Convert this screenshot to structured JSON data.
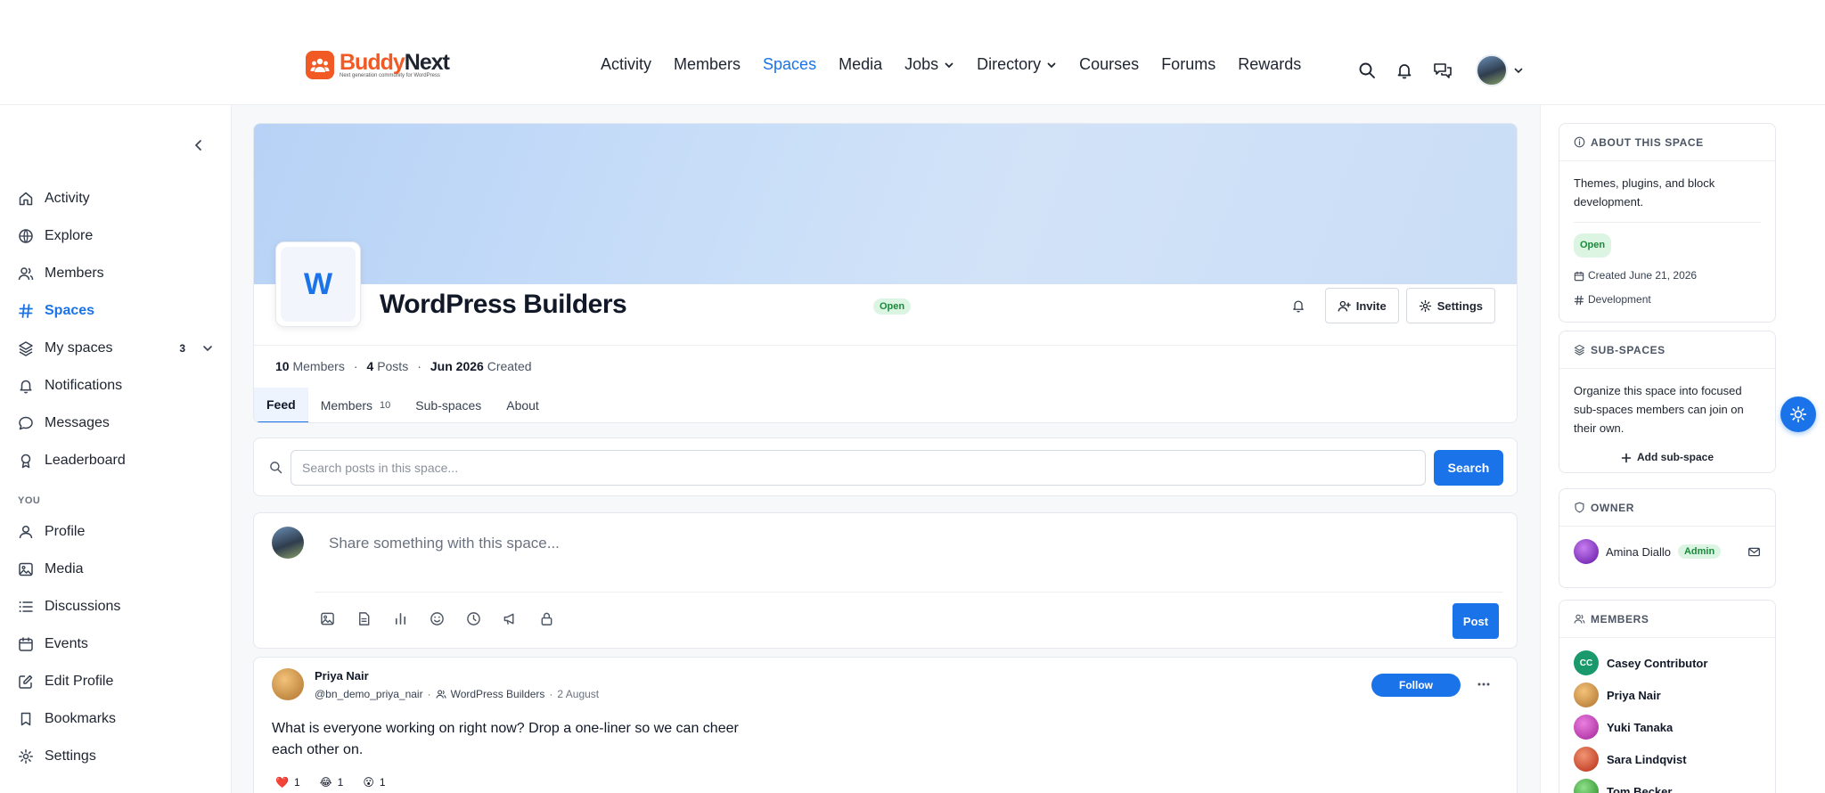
{
  "brand": {
    "name_a": "Buddy",
    "name_b": "Next",
    "tagline": "Next generation community for WordPress",
    "color": "#f15a24"
  },
  "nav": [
    {
      "label": "Activity"
    },
    {
      "label": "Members"
    },
    {
      "label": "Spaces",
      "active": true
    },
    {
      "label": "Media"
    },
    {
      "label": "Jobs",
      "dropdown": true
    },
    {
      "label": "Directory",
      "dropdown": true
    },
    {
      "label": "Courses"
    },
    {
      "label": "Forums"
    },
    {
      "label": "Rewards"
    }
  ],
  "header_icons": [
    "search-icon",
    "bell-icon",
    "messages-icon",
    "avatar",
    "chevron-down-icon"
  ],
  "sidebar": {
    "items": [
      {
        "label": "Activity",
        "icon": "home-icon"
      },
      {
        "label": "Explore",
        "icon": "globe-icon"
      },
      {
        "label": "Members",
        "icon": "user-icon"
      },
      {
        "label": "Spaces",
        "icon": "hash-icon",
        "active": true
      },
      {
        "label": "My spaces",
        "icon": "layers-icon",
        "badge": "3"
      },
      {
        "label": "Notifications",
        "icon": "bell-icon"
      },
      {
        "label": "Messages",
        "icon": "chat-icon"
      },
      {
        "label": "Leaderboard",
        "icon": "award-icon"
      }
    ],
    "section_you": "YOU",
    "you_items": [
      {
        "label": "Profile",
        "icon": "user-icon"
      },
      {
        "label": "Media",
        "icon": "image-icon"
      },
      {
        "label": "Discussions",
        "icon": "list-icon"
      },
      {
        "label": "Events",
        "icon": "calendar-icon"
      },
      {
        "label": "Edit Profile",
        "icon": "edit-icon"
      },
      {
        "label": "Bookmarks",
        "icon": "bookmark-icon"
      },
      {
        "label": "Settings",
        "icon": "gear-icon"
      }
    ]
  },
  "space": {
    "initial": "W",
    "title": "WordPress Builders",
    "status": "Open",
    "invite_label": "Invite",
    "settings_label": "Settings",
    "stats": {
      "members_count": "10",
      "members_label": "Members",
      "posts_count": "4",
      "posts_label": "Posts",
      "created_date": "Jun 2026",
      "created_label": "Created"
    },
    "tabs": [
      {
        "label": "Feed",
        "active": true
      },
      {
        "label": "Members",
        "count": "10"
      },
      {
        "label": "Sub-spaces"
      },
      {
        "label": "About"
      }
    ]
  },
  "search": {
    "placeholder": "Search posts in this space...",
    "button": "Search"
  },
  "composer": {
    "placeholder": "Share something with this space...",
    "post_label": "Post"
  },
  "post": {
    "author": "Priya Nair",
    "handle": "@bn_demo_priya_nair",
    "space": "WordPress Builders",
    "date": "2 August",
    "follow_label": "Follow",
    "body": "What is everyone working on right now? Drop a one-liner so we can cheer each other on.",
    "reactions": [
      {
        "emoji": "❤️",
        "count": "1"
      },
      {
        "emoji": "😂",
        "count": "1"
      },
      {
        "emoji": "😮",
        "count": "1"
      }
    ]
  },
  "about": {
    "heading": "ABOUT THIS SPACE",
    "description": "Themes, plugins, and block development.",
    "status": "Open",
    "created": "Created June 21, 2026",
    "category": "Development"
  },
  "subspaces": {
    "heading": "SUB-SPACES",
    "description": "Organize this space into focused sub-spaces members can join on their own.",
    "add_label": "Add sub-space"
  },
  "owner": {
    "heading": "OWNER",
    "name": "Amina Diallo",
    "role": "Admin"
  },
  "members": {
    "heading": "MEMBERS",
    "list": [
      {
        "name": "Casey Contributor",
        "initials": "CC",
        "color": "#1a9a6c"
      },
      {
        "name": "Priya Nair",
        "initials": "",
        "color": "#d59a4e"
      },
      {
        "name": "Yuki Tanaka",
        "initials": "",
        "color": "#c04fb8"
      },
      {
        "name": "Sara Lindqvist",
        "initials": "",
        "color": "#d05a3c"
      },
      {
        "name": "Tom Becker",
        "initials": "",
        "color": "#4caf50"
      }
    ]
  },
  "colors": {
    "accent": "#1a73e8",
    "success_bg": "#dcf5e3",
    "success_fg": "#198a3b"
  }
}
